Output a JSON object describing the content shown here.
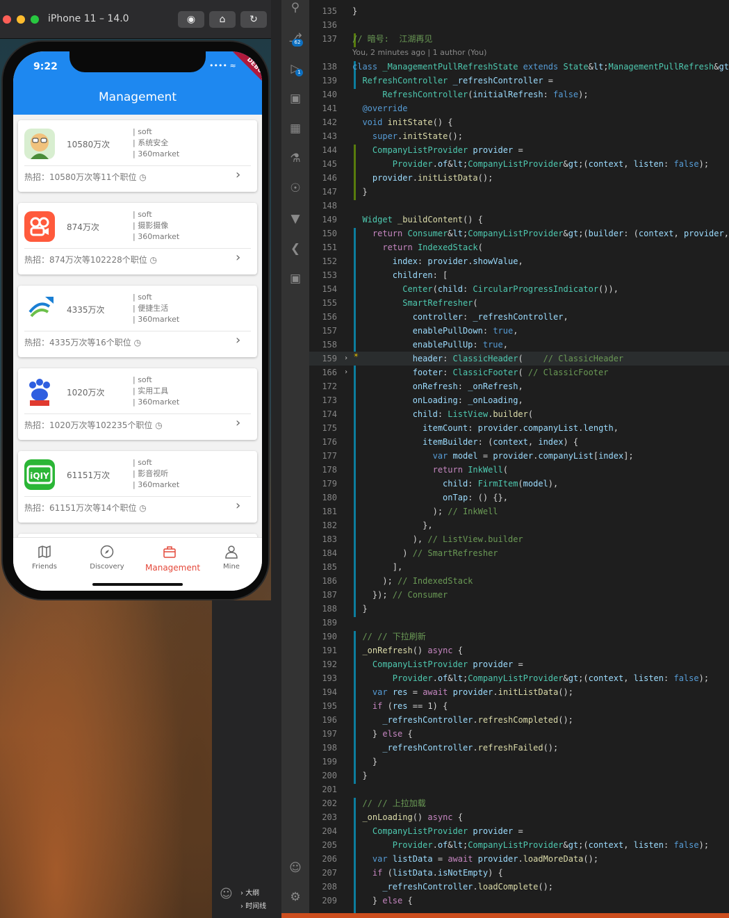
{
  "simulator": {
    "title": "iPhone 11 – 14.0",
    "screenshot_icon": "camera-icon",
    "home_icon": "home-icon",
    "rotate_icon": "rotate-icon"
  },
  "phone": {
    "time": "9:22",
    "debug_banner": "DEBUG",
    "appbar_title": "Management",
    "cards": [
      {
        "visits": "10580万次",
        "tag1": "| soft",
        "tag2": "| 系统安全",
        "tag3": "| 360market",
        "hot": "热招：10580万次等11个职位",
        "logo_color": "#6aa84f"
      },
      {
        "visits": "874万次",
        "tag1": "| soft",
        "tag2": "| 摄影摄像",
        "tag3": "| 360market",
        "hot": "热招：874万次等102228个职位",
        "logo_color": "#ff5a3c"
      },
      {
        "visits": "4335万次",
        "tag1": "| soft",
        "tag2": "| 便捷生活",
        "tag3": "| 360market",
        "hot": "热招：4335万次等16个职位",
        "logo_color": "#ffffff"
      },
      {
        "visits": "1020万次",
        "tag1": "| soft",
        "tag2": "| 实用工具",
        "tag3": "| 360market",
        "hot": "热招：1020万次等102235个职位",
        "logo_color": "#ffffff"
      },
      {
        "visits": "61151万次",
        "tag1": "| soft",
        "tag2": "| 影音视听",
        "tag3": "| 360market",
        "hot": "热招：61151万次等14个职位",
        "logo_color": "#2bb636"
      }
    ],
    "tabs": [
      {
        "label": "Friends",
        "icon": "map-icon"
      },
      {
        "label": "Discovery",
        "icon": "compass-icon"
      },
      {
        "label": "Management",
        "icon": "briefcase-icon"
      },
      {
        "label": "Mine",
        "icon": "user-icon"
      }
    ],
    "active_color": "#e4483a",
    "appbar_color": "#1e88f0"
  },
  "ide": {
    "explorer_outline": [
      "大纲",
      "时间线"
    ],
    "activity_badges": [
      "62",
      "1"
    ],
    "blame": "You, 2 minutes ago | 1 author (You)",
    "lines": [
      {
        "n": "135",
        "code": "}"
      },
      {
        "n": "136",
        "code": ""
      },
      {
        "n": "137",
        "code": "// 暗号:  江湖再见"
      },
      {
        "n": "138",
        "code": "class _ManagementPullRefreshState extends State<ManagementPullRefresh> {"
      },
      {
        "n": "139",
        "code": "  RefreshController _refreshController ="
      },
      {
        "n": "140",
        "code": "      RefreshController(initialRefresh: false);"
      },
      {
        "n": "141",
        "code": "  @override"
      },
      {
        "n": "142",
        "code": "  void initState() {"
      },
      {
        "n": "143",
        "code": "    super.initState();"
      },
      {
        "n": "144",
        "code": "    CompanyListProvider provider ="
      },
      {
        "n": "145",
        "code": "        Provider.of<CompanyListProvider>(context, listen: false);"
      },
      {
        "n": "146",
        "code": "    provider.initListData();"
      },
      {
        "n": "147",
        "code": "  }"
      },
      {
        "n": "148",
        "code": ""
      },
      {
        "n": "149",
        "code": "  Widget _buildContent() {"
      },
      {
        "n": "150",
        "code": "    return Consumer<CompanyListProvider>(builder: (context, provider, _) {"
      },
      {
        "n": "151",
        "code": "      return IndexedStack("
      },
      {
        "n": "152",
        "code": "        index: provider.showValue,"
      },
      {
        "n": "153",
        "code": "        children: ["
      },
      {
        "n": "154",
        "code": "          Center(child: CircularProgressIndicator()),"
      },
      {
        "n": "155",
        "code": "          SmartRefresher("
      },
      {
        "n": "156",
        "code": "            controller: _refreshController,"
      },
      {
        "n": "157",
        "code": "            enablePullDown: true,"
      },
      {
        "n": "158",
        "code": "            enablePullUp: true,"
      },
      {
        "n": "159",
        "code": "            header: ClassicHeader(    // ClassicHeader"
      },
      {
        "n": "166",
        "code": "            footer: ClassicFooter( // ClassicFooter"
      },
      {
        "n": "172",
        "code": "            onRefresh: _onRefresh,"
      },
      {
        "n": "173",
        "code": "            onLoading: _onLoading,"
      },
      {
        "n": "174",
        "code": "            child: ListView.builder("
      },
      {
        "n": "175",
        "code": "              itemCount: provider.companyList.length,"
      },
      {
        "n": "176",
        "code": "              itemBuilder: (context, index) {"
      },
      {
        "n": "177",
        "code": "                var model = provider.companyList[index];"
      },
      {
        "n": "178",
        "code": "                return InkWell("
      },
      {
        "n": "179",
        "code": "                  child: FirmItem(model),"
      },
      {
        "n": "180",
        "code": "                  onTap: () {},"
      },
      {
        "n": "181",
        "code": "                ); // InkWell"
      },
      {
        "n": "182",
        "code": "              },"
      },
      {
        "n": "183",
        "code": "            ), // ListView.builder"
      },
      {
        "n": "184",
        "code": "          ) // SmartRefresher"
      },
      {
        "n": "185",
        "code": "        ],"
      },
      {
        "n": "186",
        "code": "      ); // IndexedStack"
      },
      {
        "n": "187",
        "code": "    }); // Consumer"
      },
      {
        "n": "188",
        "code": "  }"
      },
      {
        "n": "189",
        "code": ""
      },
      {
        "n": "190",
        "code": "  // // 下拉刷新"
      },
      {
        "n": "191",
        "code": "  _onRefresh() async {"
      },
      {
        "n": "192",
        "code": "    CompanyListProvider provider ="
      },
      {
        "n": "193",
        "code": "        Provider.of<CompanyListProvider>(context, listen: false);"
      },
      {
        "n": "194",
        "code": "    var res = await provider.initListData();"
      },
      {
        "n": "195",
        "code": "    if (res == 1) {"
      },
      {
        "n": "196",
        "code": "      _refreshController.refreshCompleted();"
      },
      {
        "n": "197",
        "code": "    } else {"
      },
      {
        "n": "198",
        "code": "      _refreshController.refreshFailed();"
      },
      {
        "n": "199",
        "code": "    }"
      },
      {
        "n": "200",
        "code": "  }"
      },
      {
        "n": "201",
        "code": ""
      },
      {
        "n": "202",
        "code": "  // // 上拉加载"
      },
      {
        "n": "203",
        "code": "  _onLoading() async {"
      },
      {
        "n": "204",
        "code": "    CompanyListProvider provider ="
      },
      {
        "n": "205",
        "code": "        Provider.of<CompanyListProvider>(context, listen: false);"
      },
      {
        "n": "206",
        "code": "    var listData = await provider.loadMoreData();"
      },
      {
        "n": "207",
        "code": "    if (listData.isNotEmpty) {"
      },
      {
        "n": "208",
        "code": "      _refreshController.loadComplete();"
      },
      {
        "n": "209",
        "code": "    } else {"
      }
    ]
  }
}
